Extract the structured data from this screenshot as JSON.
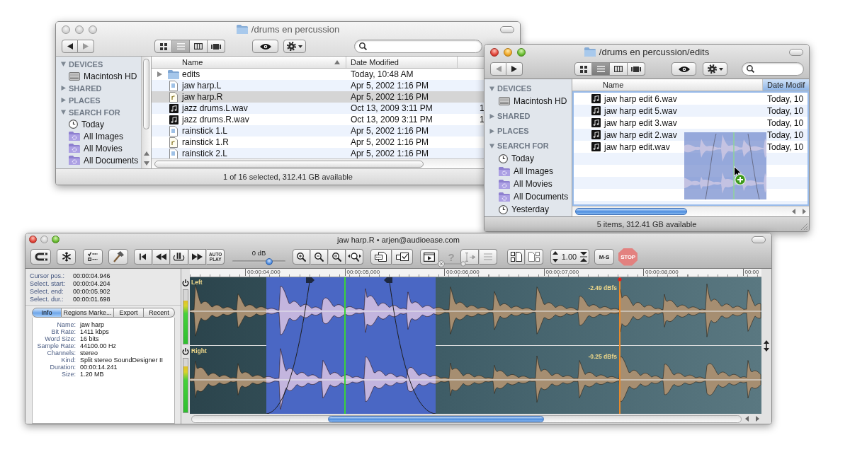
{
  "finder_back": {
    "title": "/drums en percussion",
    "traffic_lights": {
      "close": false,
      "minimize": false,
      "zoom": false
    },
    "nav": {
      "back_enabled": true,
      "forward_enabled": false
    },
    "view_modes": [
      {
        "kind": "icons",
        "selected": false
      },
      {
        "kind": "list",
        "selected": true
      },
      {
        "kind": "columns",
        "selected": false
      },
      {
        "kind": "coverflow",
        "selected": false
      }
    ],
    "sidebar": [
      {
        "kind": "header",
        "label": "DEVICES",
        "expanded": true
      },
      {
        "kind": "disk",
        "label": "Macintosh HD"
      },
      {
        "kind": "header",
        "label": "SHARED",
        "expanded": false
      },
      {
        "kind": "header",
        "label": "PLACES",
        "expanded": false
      },
      {
        "kind": "header",
        "label": "SEARCH FOR",
        "expanded": true
      },
      {
        "kind": "clock",
        "label": "Today"
      },
      {
        "kind": "smart-folder",
        "label": "All Images"
      },
      {
        "kind": "smart-folder",
        "label": "All Movies"
      },
      {
        "kind": "smart-folder",
        "label": "All Documents"
      }
    ],
    "columns": [
      {
        "label": "Name",
        "selected": false,
        "sort_arrow": true
      },
      {
        "label": "Date Modified",
        "selected": false,
        "sort_arrow": false
      }
    ],
    "rows": [
      {
        "kind": "folder",
        "name": "edits",
        "date": "Today, 10:48 AM",
        "expandable": true,
        "selected": false
      },
      {
        "kind": "document",
        "name": "jaw harp.L",
        "date": "Apr 5, 2002 1:16 PM",
        "expandable": false,
        "selected": false
      },
      {
        "kind": "resource",
        "name": "jaw harp.R",
        "date": "Apr 5, 2002 1:16 PM",
        "expandable": false,
        "selected": true
      },
      {
        "kind": "audio",
        "name": "jazz drums.L.wav",
        "date": "Oct 13, 2009 3:11 PM",
        "column_3": "1",
        "expandable": false,
        "selected": false
      },
      {
        "kind": "audio",
        "name": "jazz drums.R.wav",
        "date": "Oct 13, 2009 3:11 PM",
        "column_3": "1",
        "expandable": false,
        "selected": false
      },
      {
        "kind": "document",
        "name": "rainstick 1.L",
        "date": "Apr 5, 2002 1:16 PM",
        "expandable": false,
        "selected": false
      },
      {
        "kind": "resource",
        "name": "rainstick 1.R",
        "date": "Apr 5, 2002 1:16 PM",
        "expandable": false,
        "selected": false
      },
      {
        "kind": "document",
        "name": "rainstick 2.L",
        "date": "Apr 5, 2002 1:16 PM",
        "expandable": false,
        "selected": false
      }
    ],
    "status": "1 of 16 selected, 312.41 GB available"
  },
  "finder_front": {
    "title": "/drums en percussion/edits",
    "traffic_lights": {
      "close": true,
      "minimize": true,
      "zoom": true
    },
    "nav": {
      "back_enabled": false,
      "forward_enabled": true
    },
    "view_modes": [
      {
        "kind": "icons",
        "selected": false
      },
      {
        "kind": "list",
        "selected": true
      },
      {
        "kind": "columns",
        "selected": false
      },
      {
        "kind": "coverflow",
        "selected": false
      }
    ],
    "sidebar": [
      {
        "kind": "header",
        "label": "DEVICES",
        "expanded": true
      },
      {
        "kind": "disk",
        "label": "Macintosh HD"
      },
      {
        "kind": "header",
        "label": "SHARED",
        "expanded": false
      },
      {
        "kind": "header",
        "label": "PLACES",
        "expanded": false
      },
      {
        "kind": "header",
        "label": "SEARCH FOR",
        "expanded": true
      },
      {
        "kind": "clock",
        "label": "Today"
      },
      {
        "kind": "smart-folder",
        "label": "All Images"
      },
      {
        "kind": "smart-folder",
        "label": "All Movies"
      },
      {
        "kind": "smart-folder",
        "label": "All Documents"
      },
      {
        "kind": "clock",
        "label": "Yesterday"
      }
    ],
    "columns": [
      {
        "label": "Name",
        "selected": false,
        "sort_arrow": false
      },
      {
        "label": "Date Modif",
        "selected": true,
        "sort_arrow": false
      }
    ],
    "rows": [
      {
        "kind": "audio",
        "name": "jaw harp edit 6.wav",
        "date": "Today, 10",
        "expandable": false,
        "selected": false
      },
      {
        "kind": "audio",
        "name": "jaw harp edit 5.wav",
        "date": "Today, 10",
        "expandable": false,
        "selected": false
      },
      {
        "kind": "audio",
        "name": "jaw harp edit 3.wav",
        "date": "Today, 10",
        "expandable": false,
        "selected": false
      },
      {
        "kind": "audio",
        "name": "jaw harp edit 2.wav",
        "date": "Today, 10",
        "expandable": false,
        "selected": false
      },
      {
        "kind": "audio",
        "name": "jaw harp edit.wav",
        "date": "Today, 10",
        "expandable": false,
        "selected": false
      }
    ],
    "dragging": true,
    "status": "5 items, 312.41 GB available"
  },
  "editor": {
    "title": "jaw harp.R • arjen@audioease.com",
    "traffic_lights": {
      "close": true,
      "minimize": false,
      "zoom": true
    },
    "toolbar": {
      "tools": [
        {
          "kind": "magnet"
        },
        {
          "kind": "snowflake"
        },
        {
          "kind": "checklist"
        },
        {
          "kind": "hammer"
        }
      ],
      "transport": [
        {
          "kind": "skip-start"
        },
        {
          "kind": "rewind"
        },
        {
          "kind": "loop-play"
        },
        {
          "kind": "fast-forward"
        },
        {
          "kind": "text",
          "label": "AUTO PLAY"
        }
      ],
      "volume": {
        "reading": "0 dB",
        "level": 0.69
      },
      "zoom": [
        {
          "kind": "zoom-in"
        },
        {
          "kind": "zoom-out"
        },
        {
          "kind": "zoom-fit"
        },
        {
          "kind": "zoom-width"
        }
      ],
      "export": [
        {
          "kind": "mp3-file"
        },
        {
          "kind": "mp3-mail"
        }
      ],
      "open": [
        {
          "kind": "play-file"
        }
      ],
      "help": {
        "label": "?"
      },
      "edit": [
        {
          "kind": "text-cursor",
          "disabled": true
        },
        {
          "kind": "lines",
          "disabled": true
        }
      ],
      "docs": [
        {
          "kind": "doc-left"
        },
        {
          "kind": "doc-right"
        }
      ],
      "stepper": {
        "value": "1.00"
      },
      "ms": {
        "label": "M-S"
      },
      "stop": {
        "label": "STOP"
      }
    },
    "positions": [
      {
        "label": "Cursor pos.:",
        "value": "00:00:04.946"
      },
      {
        "label": "Select. start:",
        "value": "00:00:04.204"
      },
      {
        "label": "Select. end:",
        "value": "00:00:05.902"
      },
      {
        "label": "Select. dur.:",
        "value": "00:00:01.698"
      }
    ],
    "tabs": [
      {
        "label": "Info",
        "selected": true
      },
      {
        "label": "Regions Marke...",
        "selected": false
      },
      {
        "label": "Export",
        "selected": false
      },
      {
        "label": "Recent",
        "selected": false
      }
    ],
    "info": [
      {
        "label": "Name:",
        "value": "jaw harp"
      },
      {
        "label": "Bit Rate:",
        "value": "1411 kbps"
      },
      {
        "label": "Word Size:",
        "value": "16 bits"
      },
      {
        "label": "Sample Rate:",
        "value": "44100.00 Hz"
      },
      {
        "label": "Channels:",
        "value": "stereo"
      },
      {
        "label": "Kind:",
        "value": "Split stereo SoundDesigner II"
      },
      {
        "label": "Duration:",
        "value": "00:00:14.241"
      },
      {
        "label": "Size:",
        "value": "1.20 MB"
      }
    ],
    "ruler": [
      "00:00:04.000",
      "00:00:05.000",
      "00:00:06.000",
      "00:00:07.000",
      "00:00:08.000",
      "00:00"
    ],
    "channels": [
      {
        "name": "Left",
        "peak": "-2.49 dBfs",
        "level": 0.8
      },
      {
        "name": "Right",
        "peak": "-0.25 dBfs",
        "level": 0.85
      }
    ]
  }
}
